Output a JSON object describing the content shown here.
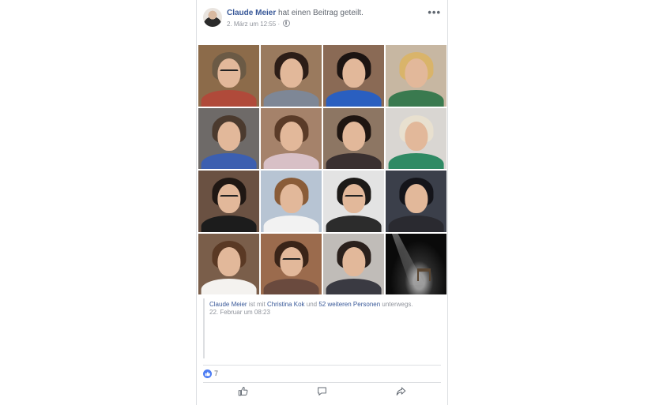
{
  "post": {
    "author": "Claude Meier",
    "action": "hat einen Beitrag geteilt.",
    "timestamp": "2. März um 12:55",
    "privacy_icon": "globe-icon",
    "more_label": "•••"
  },
  "photos": [
    {
      "bg": "#8c6b4a",
      "hair": "#6b5a45",
      "body": "#b04a3a",
      "glasses": true
    },
    {
      "bg": "#9a7a5e",
      "hair": "#2c1d17",
      "body": "#7e8796",
      "glasses": false
    },
    {
      "bg": "#8a6a55",
      "hair": "#1c1412",
      "body": "#2a5fc0",
      "glasses": false
    },
    {
      "bg": "#c7b7a2",
      "hair": "#d9b46a",
      "body": "#3a7a4f",
      "glasses": false
    },
    {
      "bg": "#6e6a68",
      "hair": "#4b3a2e",
      "body": "#3c5fb0",
      "glasses": false
    },
    {
      "bg": "#a5826a",
      "hair": "#5a3b28",
      "body": "#d8c0c6",
      "glasses": false
    },
    {
      "bg": "#8d7663",
      "hair": "#1e1511",
      "body": "#3a3030",
      "glasses": false
    },
    {
      "bg": "#d9d6d2",
      "hair": "#e8e0cf",
      "body": "#2f8a64",
      "glasses": false
    },
    {
      "bg": "#6a5142",
      "hair": "#1f1713",
      "body": "#1c1c1c",
      "glasses": true
    },
    {
      "bg": "#b7c4d3",
      "hair": "#8a5c38",
      "body": "#f2f2f2",
      "glasses": false
    },
    {
      "bg": "#e3e3e3",
      "hair": "#1d1a18",
      "body": "#2c2c2c",
      "glasses": true
    },
    {
      "bg": "#3b3f4a",
      "hair": "#14141a",
      "body": "#2a2a30",
      "glasses": false
    },
    {
      "bg": "#7a5e4a",
      "hair": "#5a3924",
      "body": "#f4f2ef",
      "glasses": false
    },
    {
      "bg": "#9b6b4d",
      "hair": "#3a2418",
      "body": "#6a4a3e",
      "glasses": true
    },
    {
      "bg": "#c0bcb8",
      "hair": "#2a201c",
      "body": "#3a3a42",
      "glasses": false
    },
    {
      "bg": "#111111",
      "hair": "#111111",
      "body": "#111111",
      "glasses": false
    }
  ],
  "shared": {
    "name": "Claude Meier",
    "with_text": "ist mit",
    "tagged": "Christina Kok",
    "and_text": "und",
    "others": "52 weiteren Personen",
    "suffix": "unterwegs.",
    "date": "22. Februar um 08:23"
  },
  "reactions": {
    "icon": "like-icon",
    "count": "7"
  },
  "actions": [
    {
      "name": "like-button",
      "icon": "thumbs-up-icon"
    },
    {
      "name": "comment-button",
      "icon": "comment-icon"
    },
    {
      "name": "share-button",
      "icon": "share-icon"
    }
  ],
  "colors": {
    "link": "#385898",
    "meta": "#90949c",
    "border": "#dddfe2",
    "like_blue": "#4c7cf3"
  }
}
